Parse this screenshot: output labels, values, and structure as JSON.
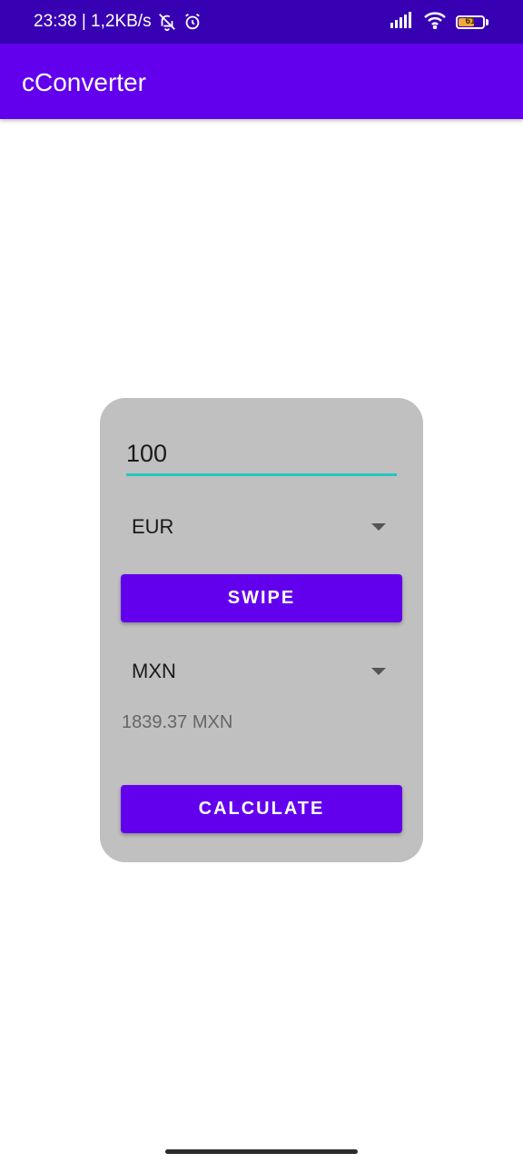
{
  "status_bar": {
    "time_speed": "23:38 | 1,2KB/s",
    "battery_level": "61",
    "icons": [
      "bell-off-icon",
      "alarm-icon",
      "signal-icon",
      "wifi-icon",
      "battery-icon"
    ],
    "background_color": "#3700b3"
  },
  "app_bar": {
    "title": "cConverter",
    "background_color": "#6200ee"
  },
  "converter": {
    "amount_value": "100",
    "from_currency": "EUR",
    "swipe_label": "SWIPE",
    "to_currency": "MXN",
    "result": "1839.37 MXN",
    "calculate_label": "CALCULATE",
    "card_color": "#c0c0c0",
    "accent_color": "#26c6c0"
  }
}
